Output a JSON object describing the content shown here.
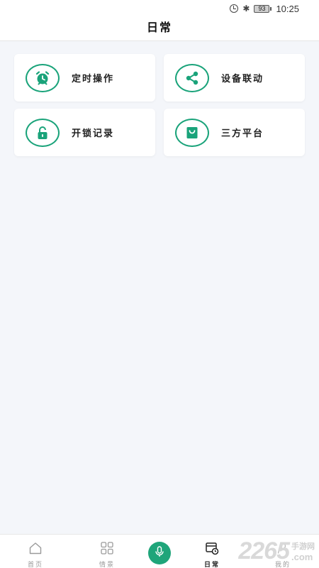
{
  "status_bar": {
    "battery": "93",
    "time": "10:25"
  },
  "header": {
    "title": "日常"
  },
  "cards": [
    {
      "label": "定时操作",
      "icon": "alarm-clock-icon"
    },
    {
      "label": "设备联动",
      "icon": "share-icon"
    },
    {
      "label": "开锁记录",
      "icon": "unlock-icon"
    },
    {
      "label": "三方平台",
      "icon": "shopping-bag-icon"
    }
  ],
  "tabbar": {
    "items": [
      {
        "label": "首页",
        "icon": "home-icon"
      },
      {
        "label": "情景",
        "icon": "grid-icon"
      },
      {
        "label": "",
        "icon": "microphone-icon"
      },
      {
        "label": "日常",
        "icon": "calendar-clock-icon",
        "active": true
      },
      {
        "label": "我的",
        "icon": "user-icon"
      }
    ]
  },
  "watermark": {
    "number": "2265",
    "top": "手游网",
    "bottom": ".com"
  },
  "colors": {
    "accent": "#1aa37a",
    "background": "#f4f6fa",
    "card": "#ffffff"
  }
}
